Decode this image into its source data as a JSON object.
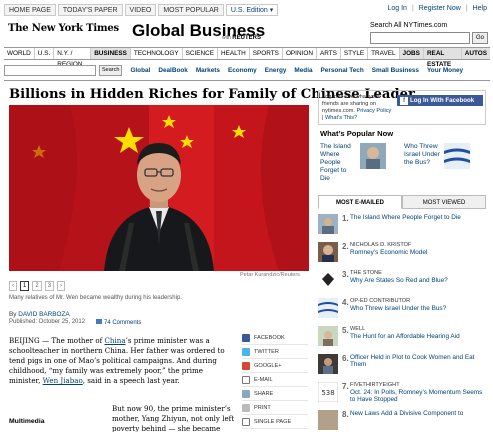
{
  "topbar": {
    "tabs": [
      "HOME PAGE",
      "TODAY'S PAPER",
      "VIDEO",
      "MOST POPULAR",
      "U.S. Edition ▾"
    ],
    "links": [
      "Log In",
      "Register Now",
      "Help"
    ]
  },
  "masthead": {
    "logo": "The New York Times",
    "section": "Global Business",
    "with_label": "with",
    "partner": "REUTERS",
    "search_label": "Search All NYTimes.com",
    "go_label": "Go"
  },
  "nav": {
    "items": [
      "WORLD",
      "U.S.",
      "N.Y. / REGION",
      "BUSINESS",
      "TECHNOLOGY",
      "SCIENCE",
      "HEALTH",
      "SPORTS",
      "OPINION",
      "ARTS",
      "STYLE",
      "TRAVEL",
      "JOBS",
      "REAL ESTATE",
      "AUTOS"
    ],
    "highlight": "BUSINESS"
  },
  "subnav": {
    "search_btn": "Search",
    "items": [
      "Global",
      "DealBook",
      "Markets",
      "Economy",
      "Energy",
      "Media",
      "Personal Tech",
      "Small Business",
      "Your Money"
    ]
  },
  "article": {
    "headline": "Billions in Hidden Riches for Family of Chinese Leader",
    "photo_credit": "Petar Kurandzic/Reuters",
    "pager": [
      "1",
      "2",
      "3"
    ],
    "caption": "Many relatives of Mr. Wen became wealthy during his leadership.",
    "byline_prefix": "By",
    "author": "DAVID BARBOZA",
    "published": "Published: October 25, 2012",
    "comments": "74 Comments",
    "p1_a": "BEIJING — The mother of ",
    "p1_link1": "China",
    "p1_b": "’s prime minister was a schoolteacher in northern China. Her father was ordered to tend pigs in one of Mao’s political campaigns. And during childhood, “my family was extremely poor,” the prime minister, ",
    "p1_link2": "Wen Jiabao",
    "p1_c": ", said in a speech last year.",
    "p2": "But now 90, the prime minister’s mother, Yang Zhiyun, not only left poverty behind — she became outright",
    "multimedia": "Multimedia"
  },
  "tools": [
    "FACEBOOK",
    "TWITTER",
    "GOOGLE+",
    "E-MAIL",
    "SHARE",
    "PRINT",
    "SINGLE PAGE"
  ],
  "facebook": {
    "prompt_a": "Log in to see what your friends are sharing on nytimes.com.",
    "privacy": "Privacy Policy",
    "sep": " | ",
    "whats_this": "What’s This?",
    "button": "Log In With Facebook"
  },
  "popular": {
    "title": "What’s Popular Now",
    "items": [
      {
        "title": "The Island Where People Forget to Die"
      },
      {
        "title": "Who Threw Israel Under the Bus?"
      }
    ]
  },
  "most": {
    "tabs": [
      "MOST E-MAILED",
      "MOST VIEWED"
    ],
    "items": [
      {
        "num": "1.",
        "kicker": "",
        "title": "The Island Where People Forget to Die"
      },
      {
        "num": "2.",
        "kicker": "NICHOLAS D. KRISTOF",
        "title": "Romney’s Economic Model"
      },
      {
        "num": "3.",
        "kicker": "THE STONE",
        "title": "Why Are States So Red and Blue?"
      },
      {
        "num": "4.",
        "kicker": "OP-ED CONTRIBUTOR",
        "title": "Who Threw Israel Under the Bus?"
      },
      {
        "num": "5.",
        "kicker": "WELL",
        "title": "The Hunt for an Affordable Hearing Aid"
      },
      {
        "num": "6.",
        "kicker": "",
        "title": "Officer Held in Plot to Cook Women and Eat Them"
      },
      {
        "num": "7.",
        "kicker": "FIVETHIRTYEIGHT",
        "title": "Oct. 24: In Polls, Romney’s Momentum Seems to Have Stopped"
      },
      {
        "num": "8.",
        "kicker": "",
        "title": "New Laws Add a Divisive Component to"
      }
    ]
  },
  "colors": {
    "link": "#004276",
    "facebook": "#3b5998",
    "flag_red": "#c8161d",
    "flag_yellow": "#ffde00"
  }
}
